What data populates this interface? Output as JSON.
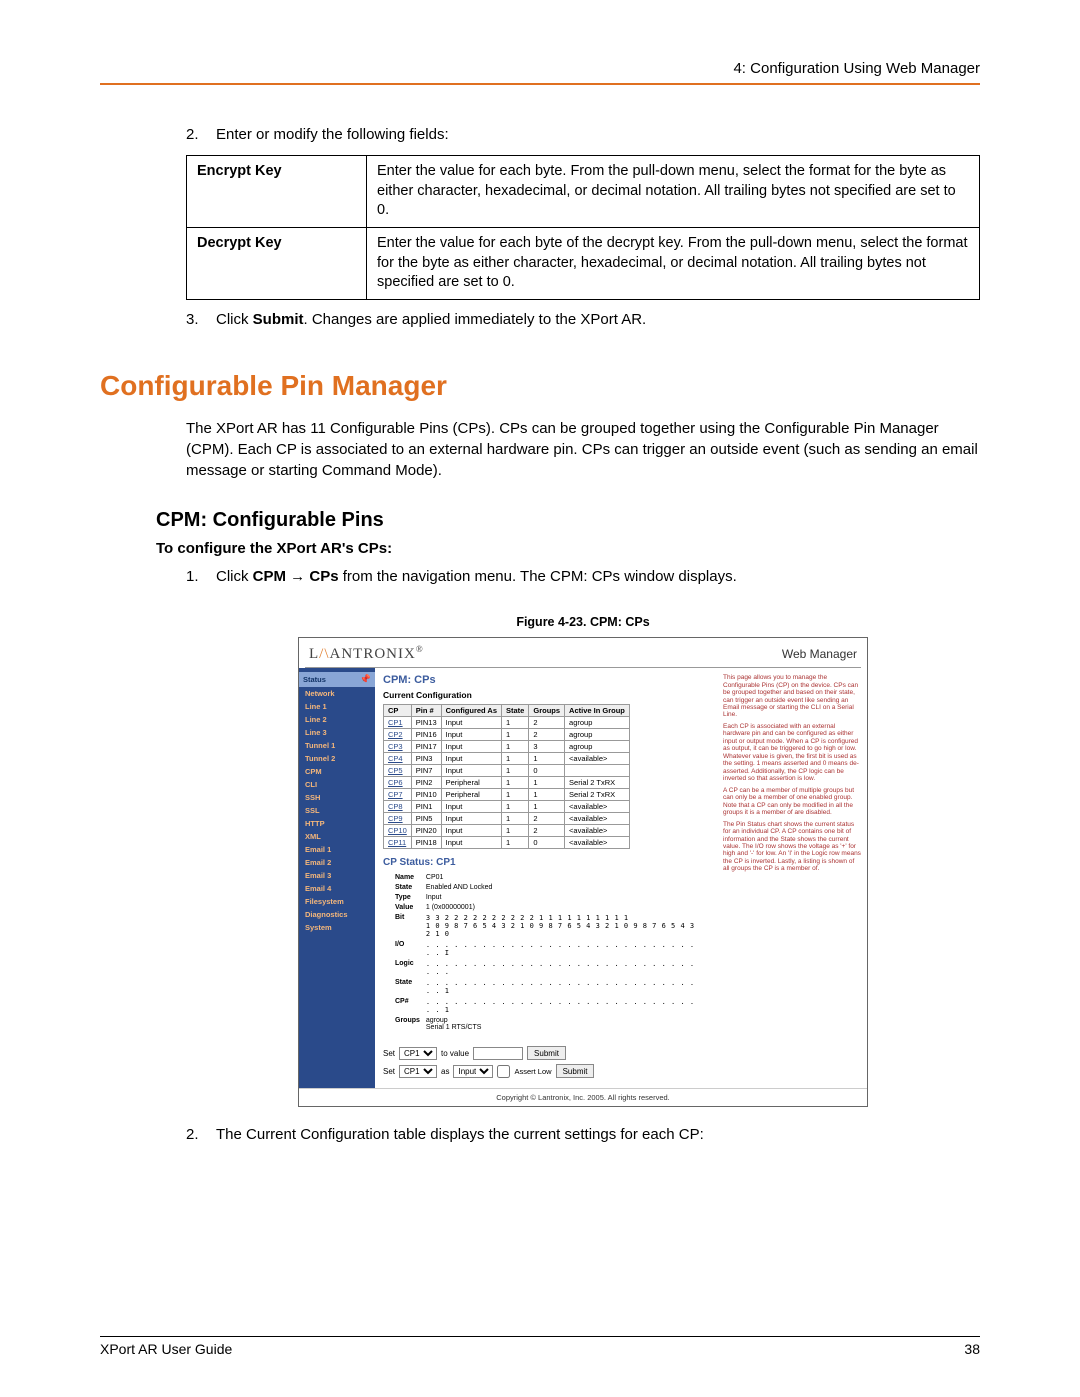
{
  "header": {
    "breadcrumb": "4: Configuration Using Web Manager"
  },
  "steps": {
    "s2": "Enter or modify the following fields:",
    "s3_pre": "Click ",
    "s3_b": "Submit",
    "s3_post": ". Changes are applied immediately to the XPort AR."
  },
  "kv": [
    {
      "k": "Encrypt Key",
      "v": "Enter the value for each byte. From the pull-down menu, select the format for the byte as either character, hexadecimal, or decimal notation.  All trailing bytes not specified are set to 0."
    },
    {
      "k": "Decrypt Key",
      "v": "Enter the value for each byte of the decrypt key. From the pull-down menu, select the format for the byte as either character, hexadecimal, or decimal notation.  All trailing bytes not specified are set to 0."
    }
  ],
  "h1": "Configurable Pin Manager",
  "para1": "The XPort AR has 11 Configurable Pins (CPs).  CPs can be grouped together using the Configurable Pin Manager (CPM).  Each CP is associated to an external hardware pin.  CPs can trigger an outside event (such as sending an email message or starting Command Mode).",
  "h2": "CPM: Configurable Pins",
  "sub_bold": "To configure the XPort AR's CPs:",
  "step1": {
    "pre": "Click ",
    "b1": "CPM",
    "arrow": " → ",
    "b2": "CPs",
    "post": " from the navigation menu. The CPM: CPs window displays."
  },
  "fig_cap": "Figure 4-23. CPM: CPs",
  "ss": {
    "logo_pre": "L",
    "logo_mid": "ANTRONI",
    "logo_post": "X",
    "wm": "Web Manager",
    "nav": [
      "Network",
      "Line 1",
      "Line 2",
      "Line 3",
      "Tunnel 1",
      "Tunnel 2",
      "CPM",
      "CLI",
      "SSH",
      "SSL",
      "HTTP",
      "XML",
      "Email 1",
      "Email 2",
      "Email 3",
      "Email 4",
      "Filesystem",
      "Diagnostics",
      "System"
    ],
    "nav_status": "Status",
    "title": "CPM: CPs",
    "sub": "Current Configuration",
    "cols": [
      "CP",
      "Pin #",
      "Configured As",
      "State",
      "Groups",
      "Active In Group"
    ],
    "rows": [
      [
        "CP1",
        "PIN13",
        "Input",
        "1",
        "2",
        "agroup"
      ],
      [
        "CP2",
        "PIN16",
        "Input",
        "1",
        "2",
        "agroup"
      ],
      [
        "CP3",
        "PIN17",
        "Input",
        "1",
        "3",
        "agroup"
      ],
      [
        "CP4",
        "PIN3",
        "Input",
        "1",
        "1",
        "<available>"
      ],
      [
        "CP5",
        "PIN7",
        "Input",
        "1",
        "0",
        ""
      ],
      [
        "CP6",
        "PIN2",
        "Peripheral",
        "1",
        "1",
        "Serial 2 TxRX"
      ],
      [
        "CP7",
        "PIN10",
        "Peripheral",
        "1",
        "1",
        "Serial 2 TxRX"
      ],
      [
        "CP8",
        "PIN1",
        "Input",
        "1",
        "1",
        "<available>"
      ],
      [
        "CP9",
        "PIN5",
        "Input",
        "1",
        "2",
        "<available>"
      ],
      [
        "CP10",
        "PIN20",
        "Input",
        "1",
        "2",
        "<available>"
      ],
      [
        "CP11",
        "PIN18",
        "Input",
        "1",
        "0",
        "<available>"
      ]
    ],
    "cp_status_title": "CP Status: CP1",
    "status": {
      "Name": "CP01",
      "State": "Enabled AND Locked",
      "Type": "Input",
      "Value": "1  (0x00000001)",
      "Bit": "3 3 2 2 2 2 2 2 2 2 2 2 1 1 1 1 1 1 1 1 1 1",
      "Bit2": "1 0 9 8 7 6 5 4 3 2 1 0 9 8 7 6 5 4 3 2 1 0 9 8 7 6 5 4 3 2 1 0",
      "IO": ". . . . . . . . . . . . . . . . . . . . . . . . . . . . . . . I",
      "Logic": ". . . . . . . . . . . . . . . . . . . . . . . . . . . . . . . .",
      "StateR": ". . . . . . . . . . . . . . . . . . . . . . . . . . . . . . . 1",
      "CP#": ". . . . . . . . . . . . . . . . . . . . . . . . . . . . . . . 1",
      "Groups": "agroup\nSerial 1 RTS/CTS"
    },
    "set1_label": "Set",
    "set1_to": "to value",
    "set1_btn": "Submit",
    "set2_label": "Set",
    "set2_as": "as",
    "set2_chk": "Assert Low",
    "set2_btn": "Submit",
    "sel_cp": "CP1",
    "sel_type": "Input",
    "info": [
      "This page allows you to manage the Configurable Pins (CP) on the device. CPs can be grouped together and based on their state, can trigger an outside event like sending an Email message or starting the CLI on a Serial Line.",
      "Each CP is associated with an external hardware pin and can be configured as either input or output mode. When a CP is configured as output, it can be triggered to go high or low. Whatever value is given, the first bit is used as the setting. 1 means asserted and 0 means de-asserted. Additionally, the CP logic can be inverted so that assertion is low.",
      "A CP can be a member of multiple groups but can only be a member of one enabled group. Note that a CP can only be modified in all the groups it is a member of are disabled.",
      "The Pin Status chart shows the current status for an individual CP. A CP contains one bit of information and the State shows the current value. The I/O row shows the voltage as '+' for high and '-' for low. An 'I' in the Logic row means the CP is inverted. Lastly, a listing is shown of all groups the CP is a member of."
    ],
    "copyright": "Copyright © Lantronix, Inc. 2005. All rights reserved."
  },
  "step_after": "The Current Configuration table displays the current settings for each CP:",
  "footer": {
    "left": "XPort AR User Guide",
    "right": "38"
  }
}
